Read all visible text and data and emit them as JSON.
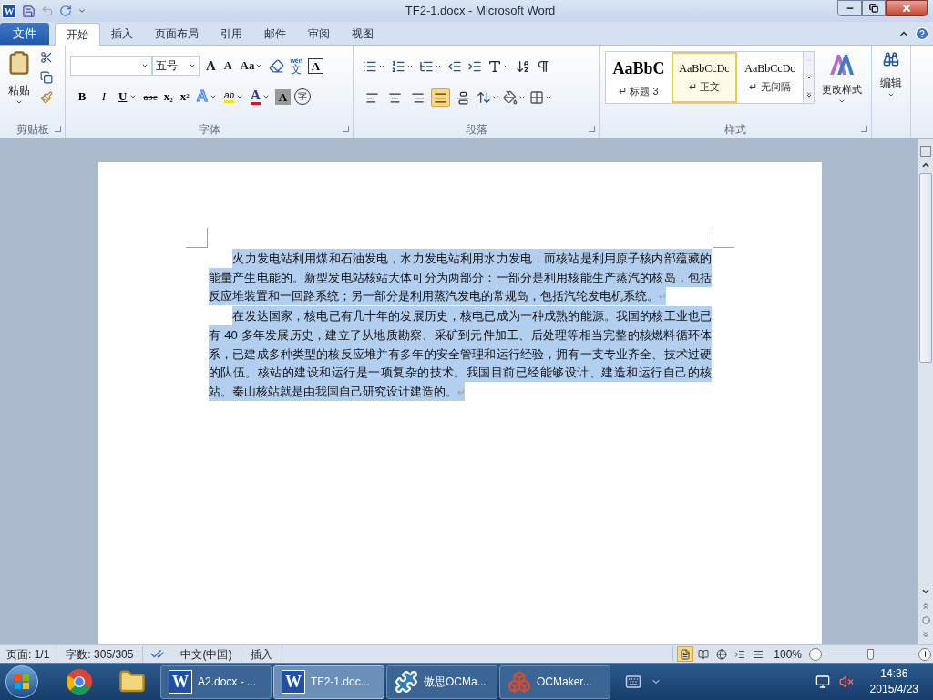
{
  "window": {
    "logo": "W",
    "title": "TF2-1.docx - Microsoft Word"
  },
  "file_tab": "文件",
  "tabs": [
    {
      "label": "开始",
      "selected": true
    },
    {
      "label": "插入",
      "selected": false
    },
    {
      "label": "页面布局",
      "selected": false
    },
    {
      "label": "引用",
      "selected": false
    },
    {
      "label": "邮件",
      "selected": false
    },
    {
      "label": "审阅",
      "selected": false
    },
    {
      "label": "视图",
      "selected": false
    }
  ],
  "ribbon": {
    "clipboard": {
      "label": "剪贴板",
      "paste": "粘贴"
    },
    "font": {
      "label": "字体",
      "font_size": "五号",
      "row1": [
        {
          "kind": "grow",
          "label": "A"
        },
        {
          "kind": "shrink",
          "label": "A"
        },
        {
          "kind": "case",
          "label": "Aa"
        },
        {
          "kind": "clear"
        },
        {
          "kind": "phonetic",
          "label": "文",
          "ruby": "wén"
        },
        {
          "kind": "border",
          "label": "A"
        }
      ],
      "row2": [
        {
          "kind": "bold",
          "label": "B"
        },
        {
          "kind": "italic",
          "label": "I"
        },
        {
          "kind": "underline",
          "label": "U"
        },
        {
          "kind": "strike",
          "label": "abc"
        },
        {
          "kind": "sub",
          "label": "x",
          "script": "2"
        },
        {
          "kind": "sup",
          "label": "x",
          "script": "2"
        },
        {
          "kind": "effects",
          "label": "A"
        },
        {
          "kind": "highlight",
          "label": "ab"
        },
        {
          "kind": "color",
          "label": "A"
        },
        {
          "kind": "shading",
          "label": "A"
        },
        {
          "kind": "enclose",
          "label": "字"
        }
      ]
    },
    "paragraph": {
      "label": "段落",
      "align": [
        {
          "selected": false
        },
        {
          "selected": false
        },
        {
          "selected": false
        },
        {
          "selected": true
        },
        {
          "selected": false
        }
      ]
    },
    "styles": {
      "label": "样式",
      "items": [
        {
          "kind": "heading",
          "preview": "AaBbC",
          "name": "↵ 标题 3",
          "selected": false
        },
        {
          "kind": "normal",
          "preview": "AaBbCcDc",
          "name": "↵ 正文",
          "selected": true
        },
        {
          "kind": "normal",
          "preview": "AaBbCcDc",
          "name": "↵ 无间隔",
          "selected": false
        }
      ],
      "change": "更改样式"
    },
    "editing": {
      "label": "编辑"
    }
  },
  "document": {
    "paragraphs": [
      {
        "text": "火力发电站利用煤和石油发电，水力发电站利用水力发电，而核站是利用原子核内部蕴藏的能量产生电能的。新型发电站核站大体可分为两部分：一部分是利用核能生产蒸汽的核岛，包括反应堆装置和一回路系统；另一部分是利用蒸汽发电的常规岛，包括汽轮发电机系统。",
        "mark": "↵",
        "selected": true
      },
      {
        "text": "在发达国家，核电已有几十年的发展历史，核电已成为一种成熟的能源。我国的核工业也已有 40 多年发展历史，建立了从地质勘察、采矿到元件加工、后处理等相当完整的核燃料循环体系，已建成多种类型的核反应堆并有多年的安全管理和运行经验，拥有一支专业齐全、技术过硬的队伍。核站的建设和运行是一项复杂的技术。我国目前已经能够设计、建造和运行自己的核站。秦山核站就是由我国自己研究设计建造的。",
        "mark": "↵",
        "selected": true
      }
    ]
  },
  "status_bar": {
    "page": "页面: 1/1",
    "words": "字数: 305/305",
    "language": "中文(中国)",
    "mode": "插入",
    "views": [
      {
        "selected": true
      },
      {
        "selected": false
      },
      {
        "selected": false
      },
      {
        "selected": false
      },
      {
        "selected": false
      }
    ],
    "zoom": {
      "reading": "100%",
      "level": 0.5
    }
  },
  "taskbar": {
    "tasks": [
      {
        "kind": "word",
        "icon_letter": "W",
        "label": "A2.docx - ...",
        "selected": false
      },
      {
        "kind": "word",
        "icon_letter": "W",
        "label": "TF2-1.doc...",
        "selected": true
      },
      {
        "kind": "puzzle",
        "label": "傲思OCMa...",
        "selected": false
      },
      {
        "kind": "cubes",
        "label": "OCMaker...",
        "selected": false
      }
    ],
    "time": "14:36",
    "date": "2015/4/23"
  }
}
